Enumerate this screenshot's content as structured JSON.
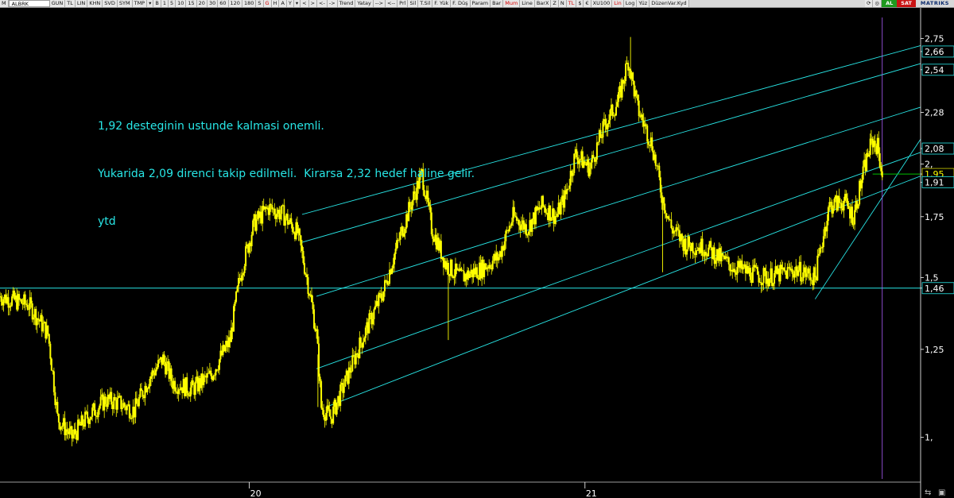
{
  "toolbar": {
    "items": [
      "M",
      "ALBRK",
      "GUN",
      "TL",
      "LIN",
      "KHN",
      "SVD",
      "SYM",
      "TMP",
      "▾",
      "B",
      "1",
      "5",
      "10",
      "15",
      "20",
      "30",
      "60",
      "120",
      "180",
      "S",
      "G",
      "H",
      "A",
      "Y",
      "▾",
      "<",
      ">",
      "<-",
      "->",
      "Trend",
      "Yatay",
      "-->",
      "<--",
      "Prl",
      "Sil",
      "T.Sil",
      "F. Yük",
      "F. Düş",
      "Param",
      "Bar",
      "Mum",
      "Line",
      "BarX",
      "Z",
      "N",
      "TL",
      "$",
      "€",
      "XU100",
      "Lin",
      "Log",
      "Yüz",
      "DüzenVar.Kyd"
    ],
    "symbol": "ALBRK",
    "buy_label": "AL",
    "sell_label": "SAT",
    "brand": "MATRIKS",
    "highlight_color": "#d80000"
  },
  "annotation": {
    "lines": [
      "1,92 desteginin ustunde kalmasi onemli.",
      "Yukarida 2,09 direnci takip edilmeli.  Kirarsa 2,32 hedef haline gelir.",
      "ytd"
    ],
    "color": "#28e6e6"
  },
  "chart_data": {
    "type": "candlestick",
    "symbol": "ALBRK",
    "colors": {
      "price": "#ffff00",
      "trendlines": "#28e6e6",
      "horizontal": "#28e6e6",
      "support": "#00c000",
      "vline": "#b060ff",
      "background": "#000000"
    },
    "y_axis": {
      "scale": "log",
      "ylim": [
        0.9,
        2.9
      ],
      "tick_labels": [
        {
          "value": 2.75,
          "label": "2,75",
          "boxed": false
        },
        {
          "value": 2.66,
          "label": "2,66",
          "boxed": true
        },
        {
          "value": 2.54,
          "label": "2,54",
          "boxed": true
        },
        {
          "value": 2.28,
          "label": "2,28",
          "boxed": false
        },
        {
          "value": 2.08,
          "label": "2,08",
          "boxed": true
        },
        {
          "value": 2.0,
          "label": "2,",
          "boxed": false
        },
        {
          "value": 1.95,
          "label": "1,95",
          "boxed": true,
          "highlight": true
        },
        {
          "value": 1.91,
          "label": "1,91",
          "boxed": true
        },
        {
          "value": 1.75,
          "label": "1,75",
          "boxed": false
        },
        {
          "value": 1.5,
          "label": "1,5",
          "boxed": false
        },
        {
          "value": 1.46,
          "label": "1,46",
          "boxed": true
        },
        {
          "value": 1.25,
          "label": "1,25",
          "boxed": false
        },
        {
          "value": 1.0,
          "label": "1,",
          "boxed": false
        }
      ]
    },
    "x_axis": {
      "index_range": [
        0,
        180
      ],
      "tick_labels": [
        {
          "index": 52,
          "label": "20"
        },
        {
          "index": 122,
          "label": "21"
        }
      ]
    },
    "price_keypoints": [
      [
        0,
        1.43
      ],
      [
        6,
        1.4
      ],
      [
        10,
        1.3
      ],
      [
        12,
        1.05
      ],
      [
        15,
        1.0
      ],
      [
        18,
        1.05
      ],
      [
        22,
        1.1
      ],
      [
        25,
        1.09
      ],
      [
        28,
        1.07
      ],
      [
        31,
        1.16
      ],
      [
        34,
        1.22
      ],
      [
        36,
        1.15
      ],
      [
        40,
        1.13
      ],
      [
        44,
        1.17
      ],
      [
        48,
        1.28
      ],
      [
        50,
        1.5
      ],
      [
        53,
        1.72
      ],
      [
        56,
        1.79
      ],
      [
        59,
        1.76
      ],
      [
        62,
        1.68
      ],
      [
        64,
        1.5
      ],
      [
        66,
        1.3
      ],
      [
        67,
        1.08
      ],
      [
        69,
        1.05
      ],
      [
        72,
        1.15
      ],
      [
        76,
        1.3
      ],
      [
        80,
        1.45
      ],
      [
        84,
        1.7
      ],
      [
        88,
        1.95
      ],
      [
        90,
        1.7
      ],
      [
        93,
        1.55
      ],
      [
        96,
        1.5
      ],
      [
        100,
        1.53
      ],
      [
        104,
        1.58
      ],
      [
        107,
        1.75
      ],
      [
        110,
        1.7
      ],
      [
        113,
        1.8
      ],
      [
        116,
        1.75
      ],
      [
        118,
        1.85
      ],
      [
        120,
        2.05
      ],
      [
        123,
        1.98
      ],
      [
        126,
        2.2
      ],
      [
        129,
        2.35
      ],
      [
        131,
        2.6
      ],
      [
        133,
        2.3
      ],
      [
        136,
        2.1
      ],
      [
        138,
        1.85
      ],
      [
        140,
        1.7
      ],
      [
        143,
        1.63
      ],
      [
        147,
        1.62
      ],
      [
        152,
        1.55
      ],
      [
        156,
        1.52
      ],
      [
        160,
        1.5
      ],
      [
        166,
        1.53
      ],
      [
        170,
        1.5
      ],
      [
        173,
        1.8
      ],
      [
        176,
        1.82
      ],
      [
        178,
        1.75
      ],
      [
        181,
        2.05
      ],
      [
        182,
        2.12
      ],
      [
        183,
        2.09
      ],
      [
        184,
        1.95
      ]
    ],
    "channel_lines": [
      {
        "from": [
          63,
          1.76
        ],
        "to": [
          192,
          2.7
        ]
      },
      {
        "from": [
          63,
          1.64
        ],
        "to": [
          192,
          2.58
        ]
      },
      {
        "from": [
          66,
          1.43
        ],
        "to": [
          192,
          2.31
        ]
      },
      {
        "from": [
          66,
          1.19
        ],
        "to": [
          192,
          2.06
        ]
      },
      {
        "from": [
          68,
          1.08
        ],
        "to": [
          192,
          1.94
        ]
      }
    ],
    "horizontal_line": 1.46,
    "support_line": 1.95,
    "rising_trendline": {
      "from": [
        170,
        1.42
      ],
      "to": [
        192,
        2.13
      ]
    },
    "vertical_marker_index": 184
  }
}
